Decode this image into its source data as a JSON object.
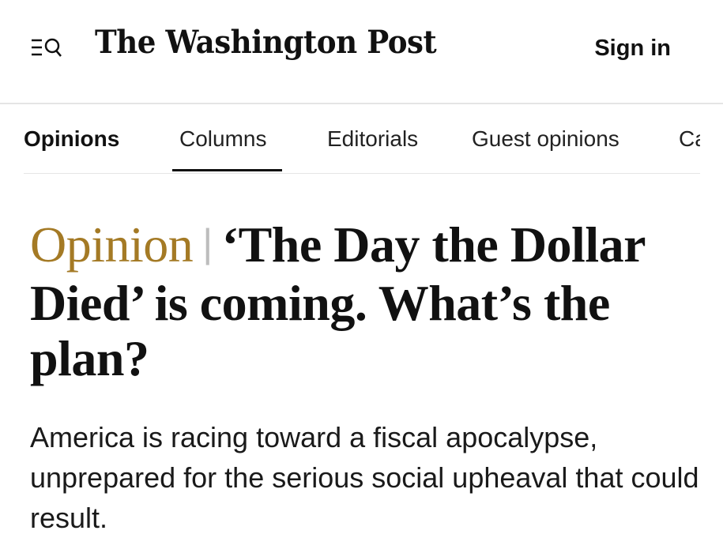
{
  "header": {
    "menu_icon": "menu-search-icon",
    "logo_text": "The Washington Post",
    "signin_label": "Sign in"
  },
  "subnav": {
    "items": [
      {
        "label": "Opinions"
      },
      {
        "label": "Columns"
      },
      {
        "label": "Editorials"
      },
      {
        "label": "Guest opinions"
      },
      {
        "label": "Ca"
      }
    ],
    "active_index": 1
  },
  "article": {
    "kicker": "Opinion",
    "divider": "|",
    "headline": "‘The Day the Dollar Died’ is coming. What’s the plan?",
    "dek": "America is racing toward a fiscal apocalypse, unprepared for the serious social upheaval that could result."
  },
  "colors": {
    "kicker": "#a47a25",
    "text": "#111111",
    "rule": "#e5e5e5"
  }
}
